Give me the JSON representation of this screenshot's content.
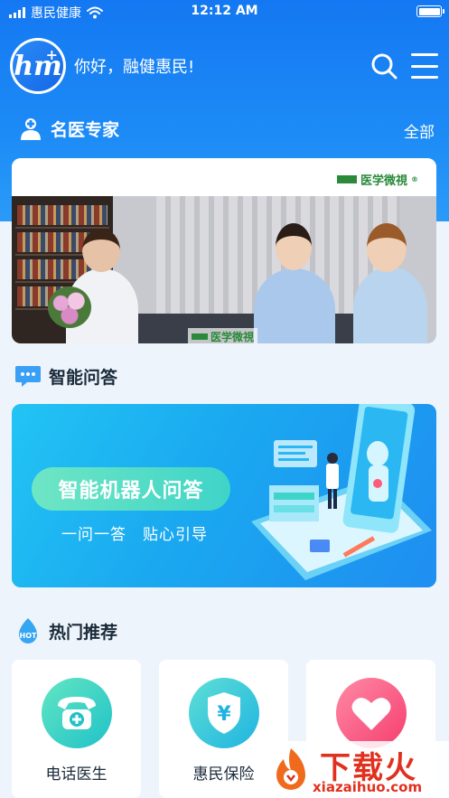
{
  "status_bar": {
    "carrier": "惠民健康",
    "time": "12:12 AM"
  },
  "header": {
    "greeting": "你好，融健惠民!",
    "logo_text": "hm"
  },
  "experts": {
    "title": "名医专家",
    "more": "全部",
    "video_brand": "医学微視",
    "video_watermark": "医学微視"
  },
  "qa": {
    "title": "智能问答",
    "button_label": "智能机器人问答",
    "subtitle": "一问一答　贴心引导"
  },
  "hot": {
    "title": "热门推荐",
    "hot_badge": "HOT",
    "items": [
      {
        "label": "电话医生",
        "icon": "phone-medical-icon",
        "color": "#20c2c8"
      },
      {
        "label": "惠民保险",
        "icon": "yen-shield-icon",
        "color": "#1fb3e0"
      },
      {
        "label": "",
        "icon": "heart-icon",
        "color": "#f53e6e"
      }
    ]
  },
  "watermark": {
    "title": "下载火",
    "url": "xiazaihuo.com"
  },
  "colors": {
    "primary": "#1478f2",
    "accent_green": "#3fd4c8",
    "page_bg": "#eef4fb"
  }
}
